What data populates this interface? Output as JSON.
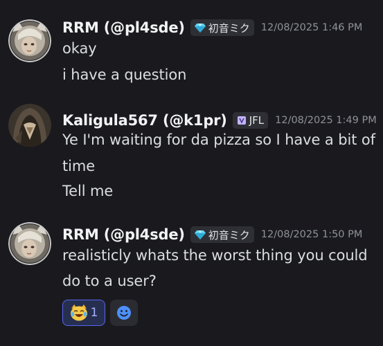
{
  "messages": [
    {
      "username": "RRM (@pl4sde)",
      "tag_label": "初音ミク",
      "tag_icon": "diamond-icon",
      "timestamp": "12/08/2025 1:46 PM",
      "lines": [
        "okay",
        "i have a question"
      ]
    },
    {
      "username": "Kaligula567 (@k1pr)",
      "tag_label": "JFL",
      "tag_icon": "clan-badge-icon",
      "timestamp": "12/08/2025 1:49 PM",
      "lines": [
        "Ye I'm waiting for da pizza so I have a bit of",
        "time",
        "Tell me"
      ]
    },
    {
      "username": "RRM (@pl4sde)",
      "tag_label": "初音ミク",
      "tag_icon": "diamond-icon",
      "timestamp": "12/08/2025 1:50 PM",
      "lines": [
        "realisticly whats the worst thing you could",
        "do to a user?"
      ]
    }
  ],
  "reactions": [
    {
      "emoji": "joy-cat-emoji",
      "count": "1",
      "active": true
    },
    {
      "emoji": "add-reaction-icon",
      "active": false
    }
  ],
  "colors": {
    "background": "#1a1a1e",
    "username": "#f2f3f5",
    "text": "#dbdee1",
    "timestamp": "#8f929a",
    "accent": "#5865f2"
  }
}
